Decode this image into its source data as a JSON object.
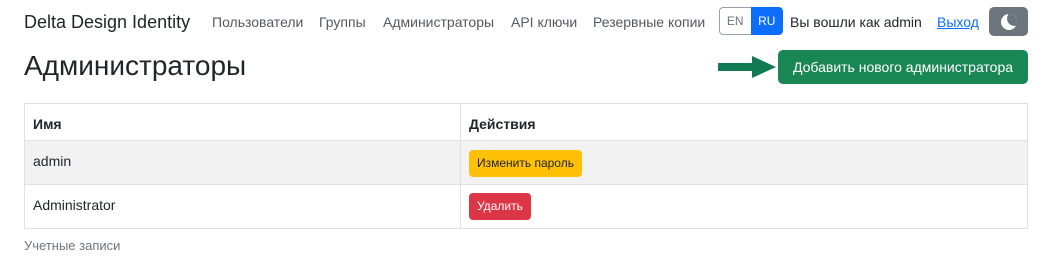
{
  "navbar": {
    "brand": "Delta Design Identity",
    "links": [
      "Пользователи",
      "Группы",
      "Администраторы",
      "API ключи",
      "Резервные копии"
    ],
    "languages": [
      "EN",
      "RU"
    ],
    "active_language": "RU",
    "logged_in_text": "Вы вошли как admin",
    "logout_label": "Выход",
    "theme_toggle_icon": "moon-icon"
  },
  "page": {
    "title": "Администраторы",
    "add_button_label": "Добавить нового администратора",
    "arrow_icon": "arrow-right-icon"
  },
  "table": {
    "headers": [
      "Имя",
      "Действия"
    ],
    "rows": [
      {
        "name": "admin",
        "action_label": "Изменить пароль"
      },
      {
        "name": "Administrator",
        "action_label": "Удалить"
      }
    ]
  },
  "footer": {
    "text": "Учетные записи"
  },
  "colors": {
    "primary": "#0d6efd",
    "success": "#198754",
    "warning": "#ffc107",
    "danger": "#dc3545",
    "secondary": "#6c757d"
  }
}
